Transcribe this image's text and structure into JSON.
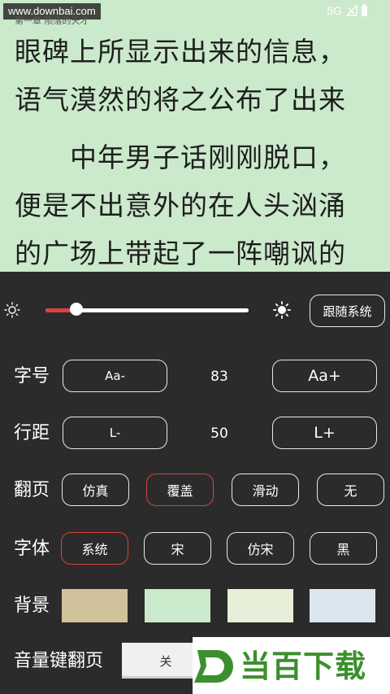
{
  "status_bar": {
    "watermark": "www.downbai.com",
    "chapter_title": "第一章 陨落的天才",
    "network": "5G",
    "signal_icon": "signal-icon",
    "battery_icon": "battery-icon"
  },
  "reader": {
    "lines": [
      "眼碑上所显示出来的信息，",
      "语气漠然的将之公布了出来",
      "　　中年男子话刚刚脱口，",
      "便是不出意外的在人头汹涌",
      "的广场上带起了一阵嘲讽的"
    ],
    "background_color": "#cbe9cb"
  },
  "brightness": {
    "level": 0.15,
    "follow_system_label": "跟随系统",
    "low_icon": "sun-small-icon",
    "high_icon": "sun-large-icon"
  },
  "font_size": {
    "label": "字号",
    "decrease_label": "Aa-",
    "value": "83",
    "increase_label": "Aa+"
  },
  "line_spacing": {
    "label": "行距",
    "decrease_label": "L-",
    "value": "50",
    "increase_label": "L+"
  },
  "page_turn": {
    "label": "翻页",
    "options": [
      "仿真",
      "覆盖",
      "滑动",
      "无"
    ],
    "selected": "覆盖"
  },
  "typeface": {
    "label": "字体",
    "options": [
      "系统",
      "宋",
      "仿宋",
      "黑"
    ],
    "selected": "系统"
  },
  "background": {
    "label": "背景",
    "swatches": [
      "#d0c39b",
      "#cbe9cb",
      "#e8efd8",
      "#dce6ef"
    ]
  },
  "volume_key": {
    "label": "音量键翻页",
    "toggle_label": "关"
  },
  "logo": {
    "text": "当百下载",
    "mark_letter": "D"
  },
  "colors": {
    "panel_bg": "#2b2b2b",
    "accent": "#d9433e",
    "logo_green": "#3c8f2e"
  }
}
